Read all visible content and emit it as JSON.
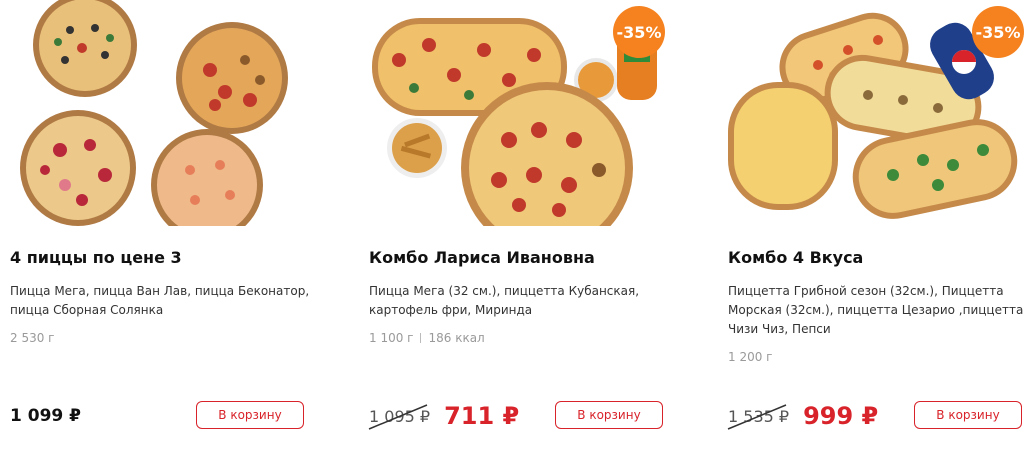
{
  "products": [
    {
      "title": "4 пиццы по цене 3",
      "description": "Пицца Мега, пицца Ван Лав, пицца Беконатор, пицца Сборная Солянка",
      "weight": "2 530 г",
      "price": "1 099 ₽",
      "button": "В корзину"
    },
    {
      "title": "Комбо Лариса Ивановна",
      "description": "Пицца Мега (32 см.), пиццетта Кубанская, картофель фри, Миринда",
      "weight": "1 100 г",
      "calories": "186 ккал",
      "badge": "-35%",
      "old_price": "1 095 ₽",
      "new_price": "711 ₽",
      "button": "В корзину"
    },
    {
      "title": "Комбо 4 Вкуса",
      "description": "Пиццетта Грибной сезон (32см.), Пиццетта Морская (32см.), пиццетта Цезарио ,пиццетта Чизи Чиз, Пепси",
      "weight": "1 200 г",
      "badge": "-35%",
      "old_price": "1 535 ₽",
      "new_price": "999 ₽",
      "button": "В корзину"
    }
  ],
  "colors": {
    "accent": "#d8232a",
    "badge": "#f5821f"
  }
}
